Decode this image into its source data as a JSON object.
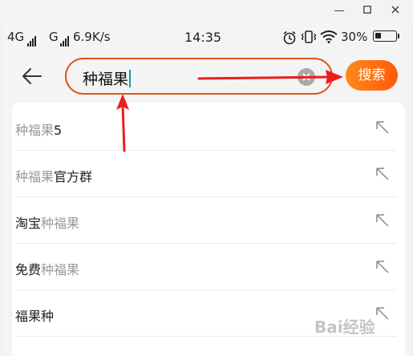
{
  "window": {
    "min_icon": "minimize-icon",
    "max_icon": "maximize-icon",
    "close_icon": "close-icon"
  },
  "statusbar": {
    "network1": "4G",
    "network2": "G",
    "speed": "6.9K/s",
    "time": "14:35",
    "battery": "30%",
    "battery_level": 0.3,
    "icons": [
      "alarm-icon",
      "vibrate-icon",
      "wifi-icon",
      "battery-icon"
    ]
  },
  "search": {
    "query": "种福果",
    "button_label": "搜索",
    "accent_color": "#e0551b",
    "button_color": "#ff6a0f"
  },
  "suggestions": [
    {
      "highlight": "种福果",
      "rest": "5"
    },
    {
      "highlight": "种福果",
      "rest": "官方群"
    },
    {
      "prefix": "淘宝",
      "highlight": "种福果"
    },
    {
      "prefix": "免费",
      "highlight": "种福果"
    },
    {
      "prefix": "福果种"
    }
  ],
  "watermark": "Bai经验"
}
